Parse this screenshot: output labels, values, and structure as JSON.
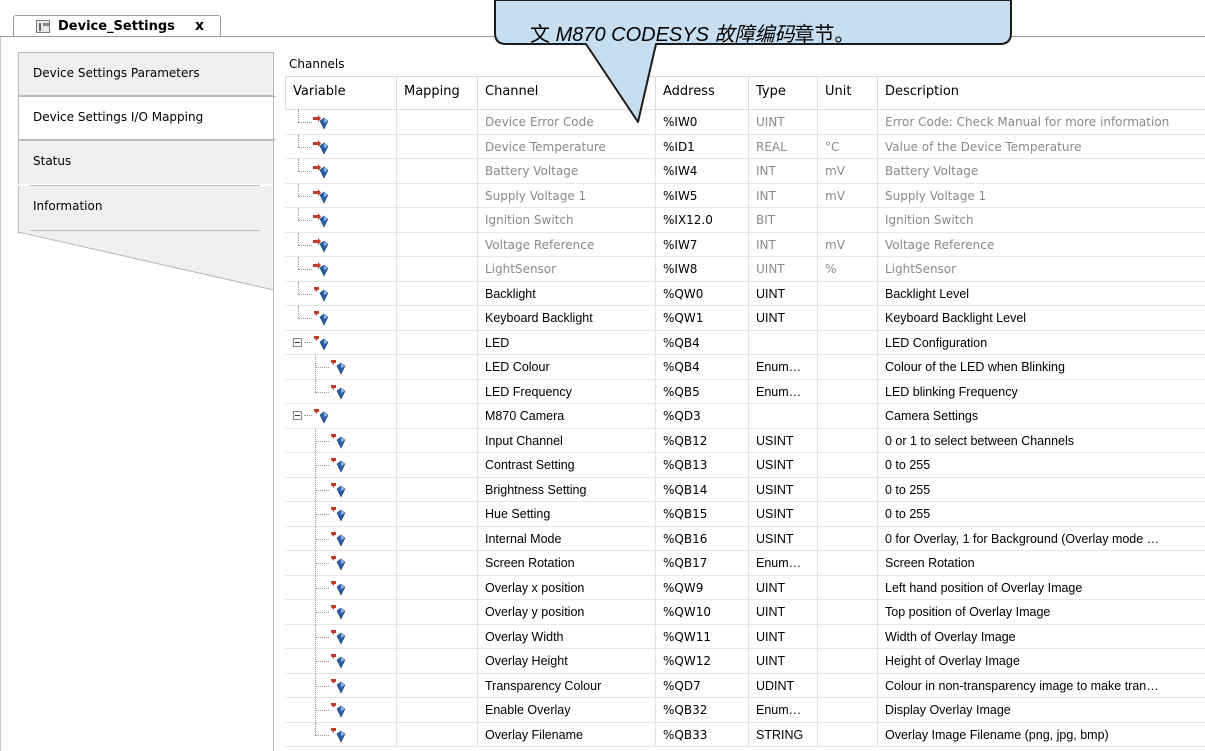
{
  "document_tab": {
    "title": "Device_Settings",
    "close": "x"
  },
  "nav": [
    {
      "label": "Device Settings Parameters",
      "selected": false
    },
    {
      "label": "Device Settings I/O Mapping",
      "selected": true
    },
    {
      "label": "Status",
      "selected": false
    },
    {
      "label": "Information",
      "selected": false
    }
  ],
  "channels_title": "Channels",
  "columns": [
    "Variable",
    "Mapping",
    "Channel",
    "Address",
    "Type",
    "Unit",
    "Description"
  ],
  "rows": [
    {
      "channel": "Device Error Code",
      "address": "%IW0",
      "type": "UINT",
      "unit": "",
      "description": "Error Code: Check Manual for more information",
      "kind": "input",
      "level": 0
    },
    {
      "channel": "Device Temperature",
      "address": "%ID1",
      "type": "REAL",
      "unit": "°C",
      "description": "Value of the Device Temperature",
      "kind": "input",
      "level": 0
    },
    {
      "channel": "Battery Voltage",
      "address": "%IW4",
      "type": "INT",
      "unit": "mV",
      "description": "Battery Voltage",
      "kind": "input",
      "level": 0
    },
    {
      "channel": "Supply Voltage 1",
      "address": "%IW5",
      "type": "INT",
      "unit": "mV",
      "description": "Supply Voltage 1",
      "kind": "input",
      "level": 0
    },
    {
      "channel": "Ignition Switch",
      "address": "%IX12.0",
      "type": "BIT",
      "unit": "",
      "description": "Ignition Switch",
      "kind": "input",
      "level": 0
    },
    {
      "channel": "Voltage Reference",
      "address": "%IW7",
      "type": "INT",
      "unit": "mV",
      "description": "Voltage Reference",
      "kind": "input",
      "level": 0
    },
    {
      "channel": "LightSensor",
      "address": "%IW8",
      "type": "UINT",
      "unit": "%",
      "description": "LightSensor",
      "kind": "input",
      "level": 0
    },
    {
      "channel": "Backlight",
      "address": "%QW0",
      "type": "UINT",
      "unit": "",
      "description": "Backlight Level",
      "kind": "output",
      "level": 0
    },
    {
      "channel": "Keyboard Backlight",
      "address": "%QW1",
      "type": "UINT",
      "unit": "",
      "description": "Keyboard Backlight Level",
      "kind": "output",
      "level": 0
    },
    {
      "channel": "LED",
      "address": "%QB4",
      "type": "",
      "unit": "",
      "description": "LED Configuration",
      "kind": "output",
      "level": 0,
      "expandable": true
    },
    {
      "channel": "LED Colour",
      "address": "%QB4",
      "type": "Enum…",
      "unit": "",
      "description": "Colour of the LED when Blinking",
      "kind": "output",
      "level": 1
    },
    {
      "channel": "LED Frequency",
      "address": "%QB5",
      "type": "Enum…",
      "unit": "",
      "description": "LED blinking Frequency",
      "kind": "output",
      "level": 1,
      "last": true
    },
    {
      "channel": "M870 Camera",
      "address": "%QD3",
      "type": "",
      "unit": "",
      "description": "Camera Settings",
      "kind": "output",
      "level": 0,
      "expandable": true
    },
    {
      "channel": "Input Channel",
      "address": "%QB12",
      "type": "USINT",
      "unit": "",
      "description": "0 or 1 to select between Channels",
      "kind": "output",
      "level": 1
    },
    {
      "channel": "Contrast Setting",
      "address": "%QB13",
      "type": "USINT",
      "unit": "",
      "description": "0 to 255",
      "kind": "output",
      "level": 1
    },
    {
      "channel": "Brightness Setting",
      "address": "%QB14",
      "type": "USINT",
      "unit": "",
      "description": "0 to 255",
      "kind": "output",
      "level": 1
    },
    {
      "channel": "Hue Setting",
      "address": "%QB15",
      "type": "USINT",
      "unit": "",
      "description": "0 to 255",
      "kind": "output",
      "level": 1
    },
    {
      "channel": "Internal Mode",
      "address": "%QB16",
      "type": "USINT",
      "unit": "",
      "description": "0 for Overlay, 1 for Background (Overlay mode …",
      "kind": "output",
      "level": 1
    },
    {
      "channel": "Screen Rotation",
      "address": "%QB17",
      "type": "Enum…",
      "unit": "",
      "description": "Screen Rotation",
      "kind": "output",
      "level": 1
    },
    {
      "channel": "Overlay x position",
      "address": "%QW9",
      "type": "UINT",
      "unit": "",
      "description": "Left hand position of Overlay Image",
      "kind": "output",
      "level": 1
    },
    {
      "channel": "Overlay y position",
      "address": "%QW10",
      "type": "UINT",
      "unit": "",
      "description": "Top position of Overlay Image",
      "kind": "output",
      "level": 1
    },
    {
      "channel": "Overlay Width",
      "address": "%QW11",
      "type": "UINT",
      "unit": "",
      "description": "Width of Overlay Image",
      "kind": "output",
      "level": 1
    },
    {
      "channel": "Overlay Height",
      "address": "%QW12",
      "type": "UINT",
      "unit": "",
      "description": "Height of Overlay Image",
      "kind": "output",
      "level": 1
    },
    {
      "channel": "Transparency Colour",
      "address": "%QD7",
      "type": "UDINT",
      "unit": "",
      "description": "Colour in non-transparency image to make tran…",
      "kind": "output",
      "level": 1
    },
    {
      "channel": "Enable Overlay",
      "address": "%QB32",
      "type": "Enum…",
      "unit": "",
      "description": "Display Overlay Image",
      "kind": "output",
      "level": 1
    },
    {
      "channel": "Overlay Filename",
      "address": "%QB33",
      "type": "STRING",
      "unit": "",
      "description": "Overlay Image Filename (png, jpg, bmp)",
      "kind": "output",
      "level": 1,
      "last": true
    }
  ],
  "callout": {
    "prefix": "文 ",
    "italic": "M870 CODESYS 故障编码",
    "suffix": "章节。"
  },
  "colors": {
    "readonly_text": "#8a8a8a",
    "callout_fill": "#c7def0",
    "icon_input_arrow": "#c0392b",
    "icon_output_arrow": "#c0392b",
    "icon_blue": "#2a5fa8",
    "tab_bg": "#f0f0f0",
    "border": "#b9b9b9"
  }
}
